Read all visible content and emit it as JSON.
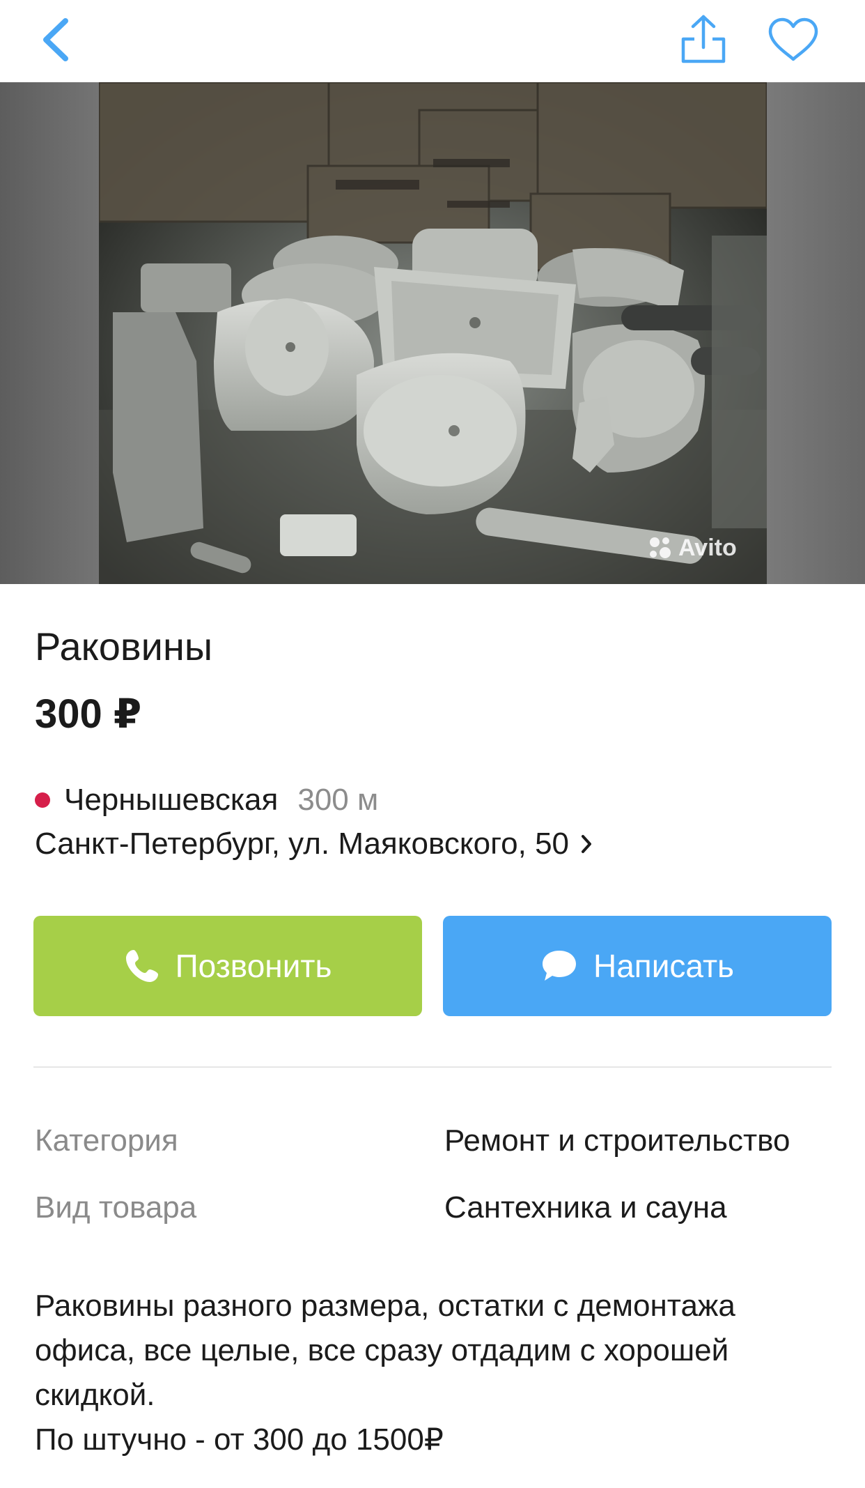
{
  "icons": {
    "back": "chevron-left-icon",
    "share": "share-icon",
    "favorite": "heart-icon",
    "phone": "phone-icon",
    "message": "chat-bubble-icon",
    "address_arrow": "chevron-right-icon"
  },
  "colors": {
    "call_button": "#a6cf48",
    "write_button": "#4aa7f5",
    "icon_blue": "#4aa7f5",
    "metro_dot": "#d61f4a"
  },
  "photo": {
    "watermark": "Avito"
  },
  "listing": {
    "title": "Раковины",
    "price": "300 ₽",
    "metro_station": "Чернышевская",
    "metro_distance": "300 м",
    "address": "Санкт-Петербург, ул. Маяковского, 50"
  },
  "actions": {
    "call_label": "Позвонить",
    "write_label": "Написать"
  },
  "params": [
    {
      "key": "Категория",
      "value": "Ремонт и строительство"
    },
    {
      "key": "Вид товара",
      "value": "Сантехника и сауна"
    }
  ],
  "description": {
    "line1": "Раковины разного размера, остатки с демонтажа офиса, все целые, все сразу отдадим с хорошей скидкой.",
    "line2": "По штучно - от 300 до 1500₽"
  }
}
